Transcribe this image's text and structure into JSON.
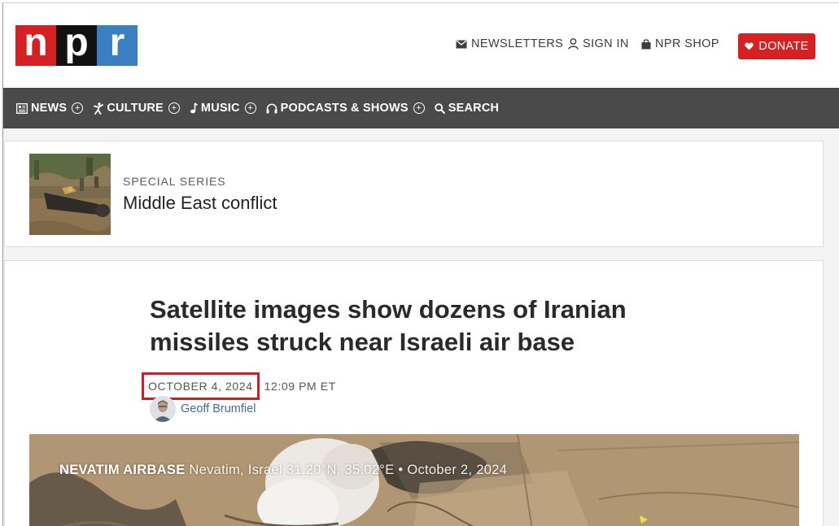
{
  "brand": {
    "logo_letters": [
      "n",
      "p",
      "r"
    ],
    "colors": {
      "n": "#d62021",
      "p": "#111111",
      "r": "#3a7fc2"
    }
  },
  "header": {
    "newsletters": "NEWSLETTERS",
    "sign_in": "SIGN IN",
    "shop": "NPR SHOP",
    "donate": "DONATE"
  },
  "nav": {
    "items": [
      {
        "label": "NEWS",
        "icon": "newspaper-icon",
        "expandable": true
      },
      {
        "label": "CULTURE",
        "icon": "dancer-icon",
        "expandable": true
      },
      {
        "label": "MUSIC",
        "icon": "music-note-icon",
        "expandable": true
      },
      {
        "label": "PODCASTS & SHOWS",
        "icon": "headphones-icon",
        "expandable": true
      },
      {
        "label": "SEARCH",
        "icon": "search-icon",
        "expandable": false
      }
    ]
  },
  "series": {
    "kicker": "SPECIAL SERIES",
    "title": "Middle East conflict"
  },
  "article": {
    "headline": "Satellite images show dozens of Iranian missiles struck near Israeli air base",
    "date": "OCTOBER 4, 2024",
    "time": "12:09 PM ET",
    "author": "Geoff Brumfiel",
    "hero_caption": {
      "bold": "NEVATIM AIRBASE",
      "rest": "Nevatim, Israel 31.20°N, 35.02°E • October 2, 2024"
    }
  },
  "colors": {
    "accent_red": "#d62021",
    "nav_bg": "#4a4a4a",
    "highlight_box": "#d11c23",
    "author_link": "#3e6b9c"
  }
}
